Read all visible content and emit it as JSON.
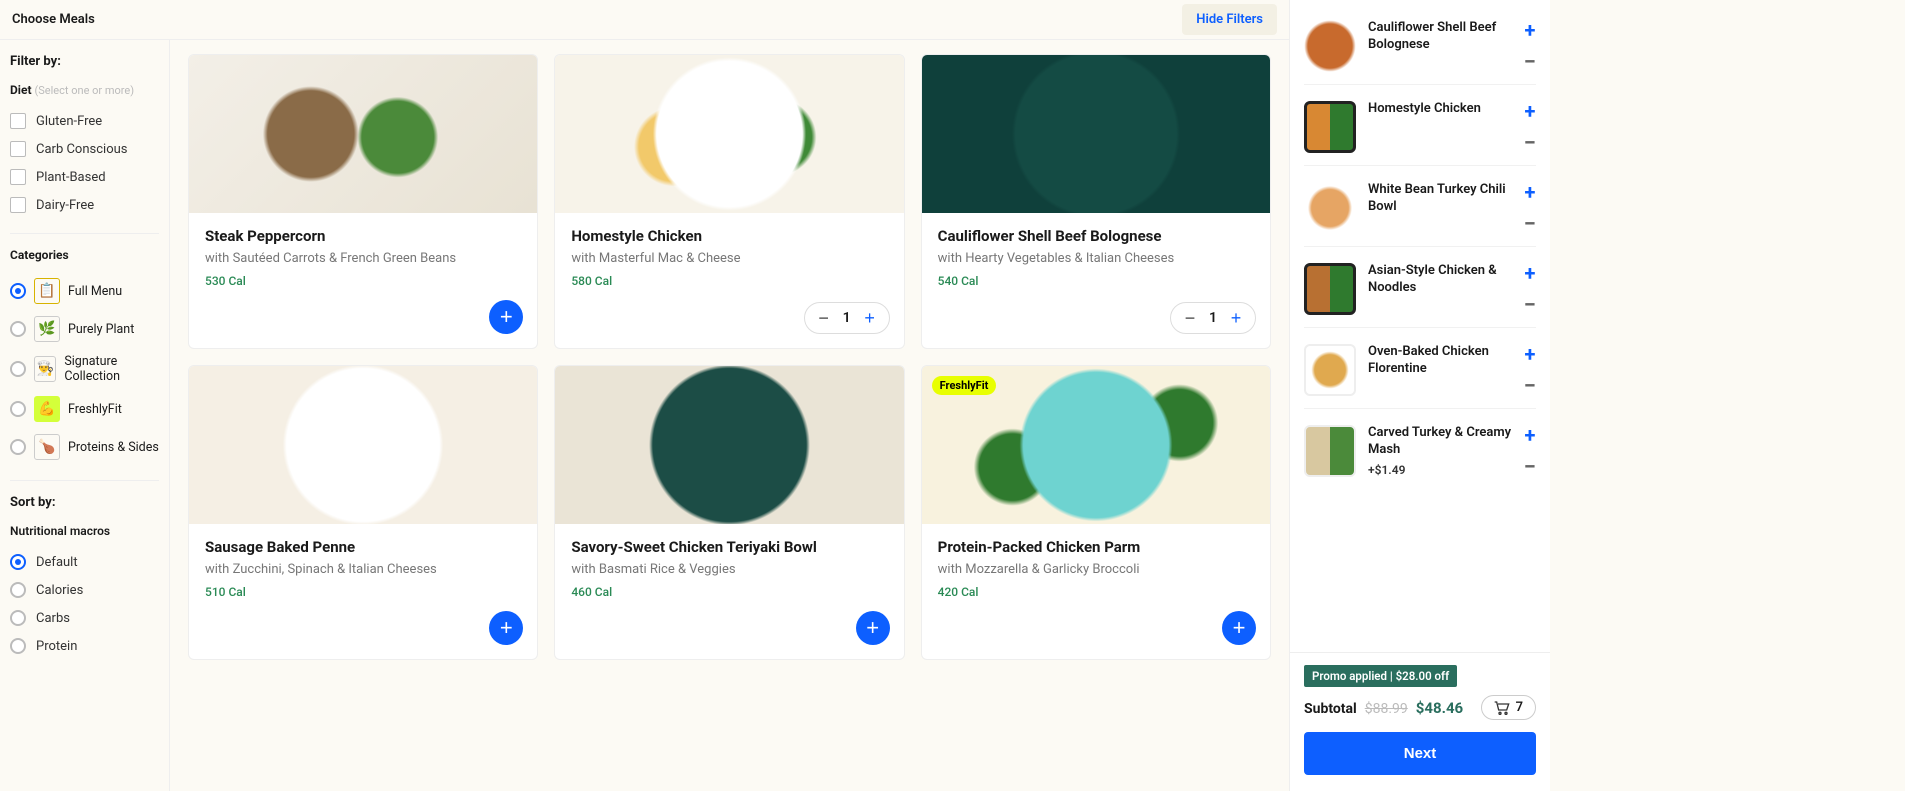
{
  "header": {
    "title": "Choose Meals",
    "hide_filters": "Hide Filters"
  },
  "sidebar": {
    "filter_by": "Filter by:",
    "diet": {
      "title": "Diet",
      "hint": "(Select one or more)",
      "options": [
        "Gluten-Free",
        "Carb Conscious",
        "Plant-Based",
        "Dairy-Free"
      ]
    },
    "categories": {
      "title": "Categories",
      "items": [
        {
          "label": "Full Menu",
          "selected": true,
          "icon": "📋"
        },
        {
          "label": "Purely Plant",
          "selected": false,
          "icon": "🌿"
        },
        {
          "label": "Signature Collection",
          "selected": false,
          "icon": "👨‍🍳"
        },
        {
          "label": "FreshlyFit",
          "selected": false,
          "icon": "💪"
        },
        {
          "label": "Proteins & Sides",
          "selected": false,
          "icon": "🍗"
        }
      ]
    },
    "sort": {
      "title": "Sort by:",
      "section_label": "Nutritional macros",
      "options": [
        "Default",
        "Calories",
        "Carbs",
        "Protein"
      ],
      "selected": "Default"
    }
  },
  "meals": [
    {
      "title": "Steak Peppercorn",
      "sub": "with Sautéed Carrots & French Green Beans",
      "cal": "530 Cal",
      "qty": 0,
      "badge": null,
      "img": "img-steak"
    },
    {
      "title": "Homestyle Chicken",
      "sub": "with Masterful Mac & Cheese",
      "cal": "580 Cal",
      "qty": 1,
      "badge": null,
      "img": "img-chicken"
    },
    {
      "title": "Cauliflower Shell Beef Bolognese",
      "sub": "with Hearty Vegetables & Italian Cheeses",
      "cal": "540 Cal",
      "qty": 1,
      "badge": null,
      "img": "img-bolognese"
    },
    {
      "title": "Sausage Baked Penne",
      "sub": "with Zucchini, Spinach & Italian Cheeses",
      "cal": "510 Cal",
      "qty": 0,
      "badge": null,
      "img": "img-penne"
    },
    {
      "title": "Savory-Sweet Chicken Teriyaki Bowl",
      "sub": "with Basmati Rice & Veggies",
      "cal": "460 Cal",
      "qty": 0,
      "badge": null,
      "img": "img-teriyaki"
    },
    {
      "title": "Protein-Packed Chicken Parm",
      "sub": "with Mozzarella & Garlicky Broccoli",
      "cal": "420 Cal",
      "qty": 0,
      "badge": "FreshlyFit",
      "img": "img-parm"
    }
  ],
  "cart": {
    "items": [
      {
        "name": "Cauliflower Shell Beef Bolognese",
        "extra": null,
        "thumb": "t-bolo"
      },
      {
        "name": "Homestyle Chicken",
        "extra": null,
        "thumb": "t-chick"
      },
      {
        "name": "White Bean Turkey Chili Bowl",
        "extra": null,
        "thumb": "t-chili"
      },
      {
        "name": "Asian-Style Chicken & Noodles",
        "extra": null,
        "thumb": "t-asian"
      },
      {
        "name": "Oven-Baked Chicken Florentine",
        "extra": null,
        "thumb": "t-florentine"
      },
      {
        "name": "Carved Turkey & Creamy Mash",
        "extra": "+$1.49",
        "thumb": "t-turkey"
      }
    ],
    "promo": "Promo applied | $28.00 off",
    "subtotal_label": "Subtotal",
    "price_old": "$88.99",
    "price_new": "$48.46",
    "count": "7",
    "next": "Next"
  }
}
